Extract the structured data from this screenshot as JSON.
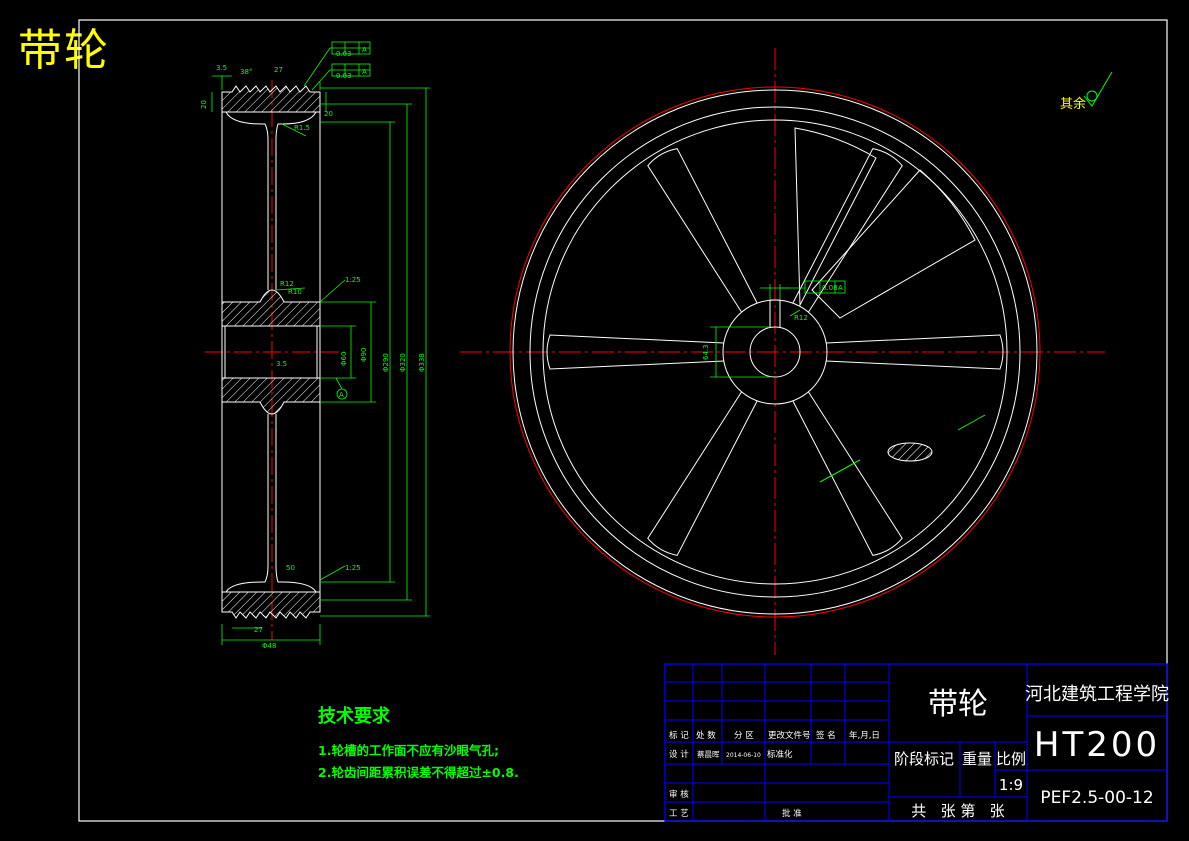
{
  "header": {
    "title": "带轮"
  },
  "roughness_note": "其余",
  "dimensions": {
    "d1": "3.5",
    "d2": "38°",
    "d3": "27",
    "d4": "20",
    "d5": "20",
    "d6": "R1.5",
    "d7": "R12",
    "d8": "R10",
    "d9": "1:25",
    "d10": "3.5",
    "d11": "Φ60",
    "d12": "Φ90",
    "d13": "Φ290",
    "d14": "Φ320",
    "d15": "Φ338",
    "d16": "1:25",
    "d17": "50",
    "d18": "27",
    "d19": "Φ48",
    "d20": "64.3",
    "d21": "R12",
    "tol1": "0.03",
    "tol2": "0.03",
    "tol3": "0.08",
    "tol_ref": "A",
    "datum": "A"
  },
  "tech_requirements": {
    "title": "技术要求",
    "items": [
      "1.轮槽的工作面不应有沙眼气孔;",
      "2.轮齿间距累积误差不得超过±0.8."
    ]
  },
  "title_block": {
    "part_name": "带轮",
    "school": "河北建筑工程学院",
    "material": "HT200",
    "drawing_no": "PEF2.5-00-12",
    "stage_label": "阶段标记",
    "weight_label": "重量",
    "scale_label": "比例",
    "scale_value": "1:9",
    "sheets_label": "共   张 第   张",
    "col_mark": "标 记",
    "col_count": "处 数",
    "col_zone": "分  区",
    "col_docno": "更改文件号",
    "col_sign": "签 名",
    "col_date": "年,月,日",
    "design_label": "设 计",
    "designer": "蔡晨晖",
    "design_date": "2014-06-10",
    "standard_label": "标准化",
    "review_label": "审 核",
    "process_label": "工 艺",
    "approve_label": "批 准"
  },
  "colors": {
    "background": "#000000",
    "outline": "#ffffff",
    "dimension": "#00ff00",
    "centerline": "#ff0000",
    "title_text": "#ffff00",
    "title_block": "#0000ff"
  }
}
